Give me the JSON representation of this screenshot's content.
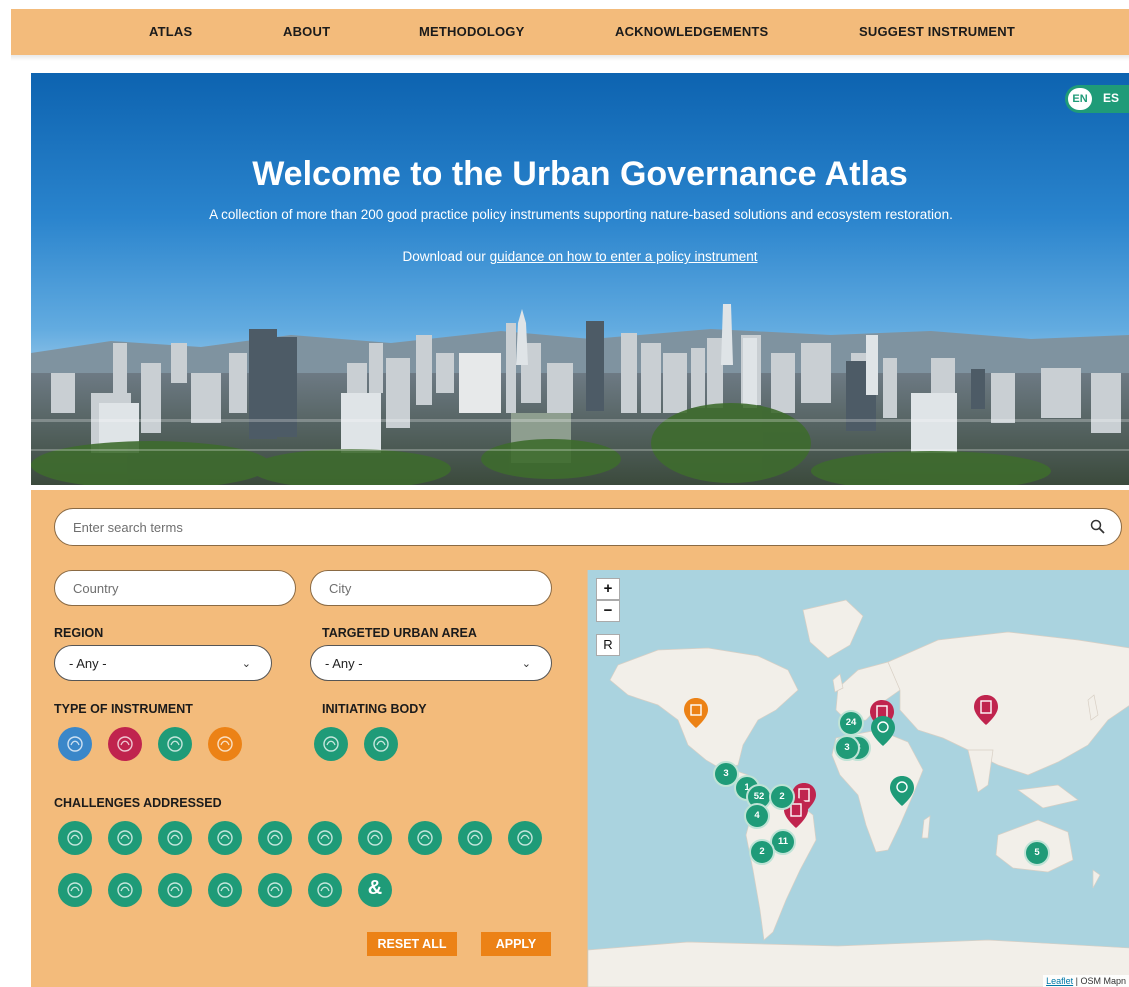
{
  "nav": {
    "items": [
      "ATLAS",
      "ABOUT",
      "METHODOLOGY",
      "ACKNOWLEDGEMENTS",
      "SUGGEST INSTRUMENT"
    ]
  },
  "lang": {
    "en": "EN",
    "es": "ES"
  },
  "hero": {
    "title": "Welcome to the Urban Governance Atlas",
    "subtitle": "A collection of more than 200 good practice policy instruments supporting nature-based solutions and ecosystem restoration.",
    "download_prefix": "Download our ",
    "download_link": "guidance on how to enter a policy instrument"
  },
  "filters": {
    "search_placeholder": "Enter search terms",
    "country_placeholder": "Country",
    "city_placeholder": "City",
    "region_label": "REGION",
    "region_value": "- Any -",
    "urban_area_label": "TARGETED URBAN AREA",
    "urban_area_value": "- Any -",
    "type_label": "TYPE OF INSTRUMENT",
    "initiating_label": "INITIATING BODY",
    "challenges_label": "CHALLENGES ADDRESSED",
    "reset_label": "RESET ALL",
    "apply_label": "APPLY"
  },
  "instrument_types": [
    {
      "icon": "handshake-icon",
      "color": "#3a87c9"
    },
    {
      "icon": "document-icon",
      "color": "#c0244e"
    },
    {
      "icon": "lightbulb-icon",
      "color": "#1f9b78"
    },
    {
      "icon": "money-icon",
      "color": "#ec8216"
    }
  ],
  "initiating_bodies": [
    {
      "icon": "government-building-icon",
      "color": "#1f9b78"
    },
    {
      "icon": "people-icon",
      "color": "#1f9b78"
    }
  ],
  "challenges": [
    "biodiversity-icon",
    "plant-icon",
    "water-icon",
    "urban-green-icon",
    "water-quality-icon",
    "forest-icon",
    "infrastructure-icon",
    "climate-icon",
    "flood-icon",
    "soil-icon",
    "health-icon",
    "community-icon",
    "social-cohesion-icon",
    "care-icon",
    "growth-icon",
    "wellbeing-icon",
    "participation-icon"
  ],
  "challenge_last_glyph": "&",
  "map": {
    "zoom_in": "+",
    "zoom_out": "−",
    "reset": "R",
    "attribution_link": "Leaflet",
    "attribution_rest": " | OSM Mapn",
    "clusters": [
      "3",
      "24",
      "3",
      "3",
      "1",
      "52",
      "2",
      "4",
      "11",
      "2",
      "5"
    ]
  },
  "colors": {
    "accent": "#f3bb7b",
    "green": "#1f9b78",
    "red": "#c0244e",
    "orange": "#ec8216",
    "blue": "#3a87c9"
  }
}
